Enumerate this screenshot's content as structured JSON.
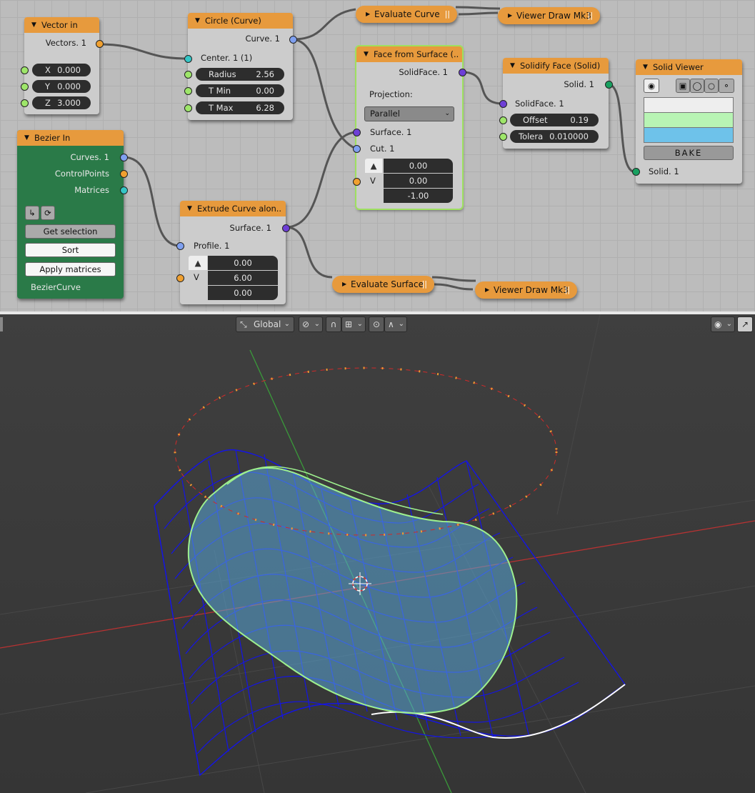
{
  "nodes": {
    "vector_in": {
      "title": "Vector in",
      "output_label": "Vectors. 1",
      "fields": [
        {
          "label": "X",
          "value": "0.000"
        },
        {
          "label": "Y",
          "value": "0.000"
        },
        {
          "label": "Z",
          "value": "3.000"
        }
      ]
    },
    "circle_curve": {
      "title": "Circle (Curve)",
      "output_label": "Curve. 1",
      "input_label": "Center. 1 (1)",
      "fields": [
        {
          "label": "Radius",
          "value": "2.56"
        },
        {
          "label": "T Min",
          "value": "0.00"
        },
        {
          "label": "T Max",
          "value": "6.28"
        }
      ]
    },
    "bezier_in": {
      "title": "Bezier In",
      "outputs": [
        "Curves. 1",
        "ControlPoints",
        "Matrices"
      ],
      "buttons": [
        "Get selection",
        "Sort",
        "Apply matrices"
      ],
      "object_name": "BezierCurve"
    },
    "extrude": {
      "title": "Extrude Curve alon..",
      "output_label": "Surface. 1",
      "input_label": "Profile. 1",
      "vector_label": "V",
      "values": [
        "0.00",
        "6.00",
        "0.00"
      ]
    },
    "face_from_surface": {
      "title": "Face from Surface (..",
      "output_label": "SolidFace. 1",
      "projection_label": "Projection:",
      "projection_value": "Parallel",
      "inputs": [
        "Surface. 1",
        "Cut. 1"
      ],
      "vector_label": "V",
      "values": [
        "0.00",
        "0.00",
        "-1.00"
      ]
    },
    "solidify": {
      "title": "Solidify Face (Solid)",
      "output_label": "Solid. 1",
      "input_label": "SolidFace. 1",
      "fields": [
        {
          "label": "Offset",
          "value": "0.19"
        },
        {
          "label": "Tolera",
          "value": "0.010000"
        }
      ]
    },
    "solid_viewer": {
      "title": "Solid Viewer",
      "bake_label": "BAKE",
      "input_label": "Solid. 1"
    },
    "evaluate_curve": {
      "title": "Evaluate Curve"
    },
    "viewer_draw_1": {
      "title": "Viewer Draw Mk3"
    },
    "evaluate_surface": {
      "title": "Evaluate Surface"
    },
    "viewer_draw_2": {
      "title": "Viewer Draw Mk3"
    }
  },
  "viewport_header": {
    "orientation": "Global"
  },
  "colors": {
    "node_header": "#e79a3d",
    "node_body": "#cccccc",
    "green_node": "#2a7a48",
    "surface_grid": "#1515e0",
    "circle_curve": "#d02a2a",
    "solid_fill": "#5aa8d8"
  }
}
